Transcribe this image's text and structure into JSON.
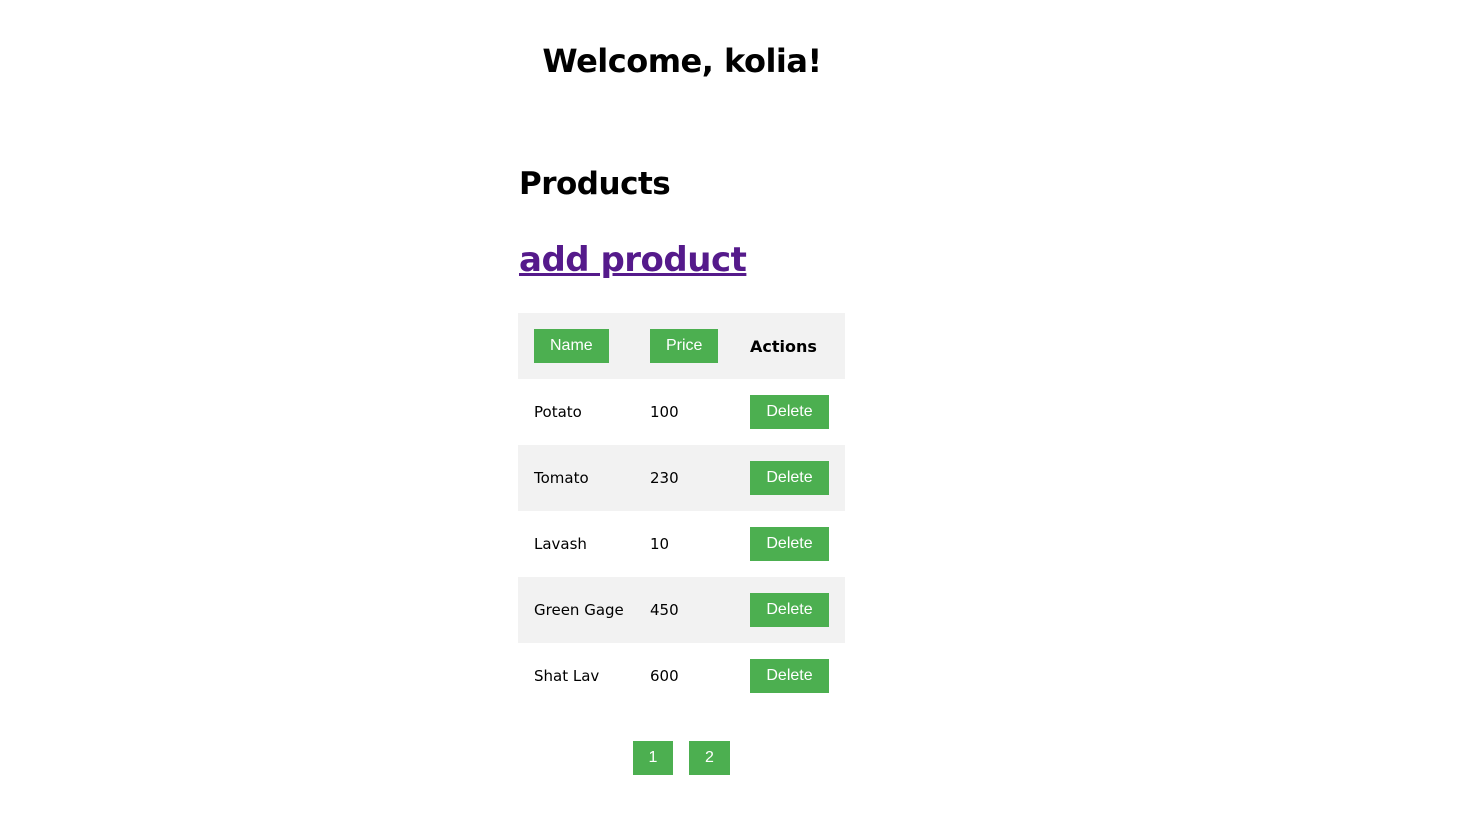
{
  "header": {
    "welcome": "Welcome, kolia!"
  },
  "products": {
    "title": "Products",
    "add_link": "add product",
    "columns": {
      "name": "Name",
      "price": "Price",
      "actions": "Actions"
    },
    "rows": [
      {
        "name": "Potato",
        "price": "100",
        "action": "Delete"
      },
      {
        "name": "Tomato",
        "price": "230",
        "action": "Delete"
      },
      {
        "name": "Lavash",
        "price": "10",
        "action": "Delete"
      },
      {
        "name": "Green Gage",
        "price": "450",
        "action": "Delete"
      },
      {
        "name": "Shat Lav",
        "price": "600",
        "action": "Delete"
      }
    ]
  },
  "pagination": {
    "pages": [
      "1",
      "2"
    ]
  },
  "colors": {
    "button": "#4caf50",
    "link": "#551a8b",
    "row_stripe": "#f2f2f2"
  }
}
